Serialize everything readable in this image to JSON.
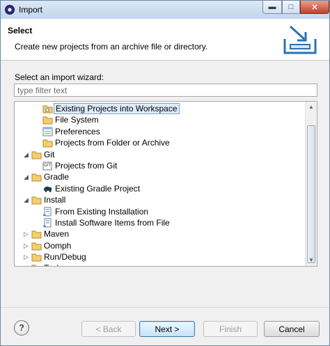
{
  "window": {
    "title": "Import"
  },
  "header": {
    "title": "Select",
    "description": "Create new projects from an archive file or directory."
  },
  "wizard": {
    "label": "Select an import wizard:",
    "filter_placeholder": "type filter text",
    "tree": [
      {
        "label": "Existing Projects into Workspace",
        "level": 1,
        "expander": "",
        "icon": "project-folder-icon",
        "selected": true
      },
      {
        "label": "File System",
        "level": 1,
        "expander": "",
        "icon": "folder-icon",
        "selected": false
      },
      {
        "label": "Preferences",
        "level": 1,
        "expander": "",
        "icon": "preferences-icon",
        "selected": false
      },
      {
        "label": "Projects from Folder or Archive",
        "level": 1,
        "expander": "",
        "icon": "folder-icon",
        "selected": false
      },
      {
        "label": "Git",
        "level": 0,
        "expander": "expanded",
        "icon": "folder-icon",
        "selected": false
      },
      {
        "label": "Projects from Git",
        "level": 1,
        "expander": "",
        "icon": "git-icon",
        "selected": false
      },
      {
        "label": "Gradle",
        "level": 0,
        "expander": "expanded",
        "icon": "folder-icon",
        "selected": false
      },
      {
        "label": "Existing Gradle Project",
        "level": 1,
        "expander": "",
        "icon": "gradle-elephant-icon",
        "selected": false
      },
      {
        "label": "Install",
        "level": 0,
        "expander": "expanded",
        "icon": "folder-icon",
        "selected": false
      },
      {
        "label": "From Existing Installation",
        "level": 1,
        "expander": "",
        "icon": "install-icon",
        "selected": false
      },
      {
        "label": "Install Software Items from File",
        "level": 1,
        "expander": "",
        "icon": "install-icon",
        "selected": false
      },
      {
        "label": "Maven",
        "level": 0,
        "expander": "collapsed",
        "icon": "folder-icon",
        "selected": false
      },
      {
        "label": "Oomph",
        "level": 0,
        "expander": "collapsed",
        "icon": "folder-icon",
        "selected": false
      },
      {
        "label": "Run/Debug",
        "level": 0,
        "expander": "collapsed",
        "icon": "folder-icon",
        "selected": false
      },
      {
        "label": "Tasks",
        "level": 0,
        "expander": "collapsed",
        "icon": "folder-icon",
        "selected": false
      }
    ]
  },
  "footer": {
    "help_glyph": "?",
    "back_label": "< Back",
    "next_label": "Next >",
    "finish_label": "Finish",
    "cancel_label": "Cancel"
  },
  "colors": {
    "selection": "#dcebfc",
    "selection_border": "#7da2ce",
    "folder": "#f4cf6e"
  }
}
